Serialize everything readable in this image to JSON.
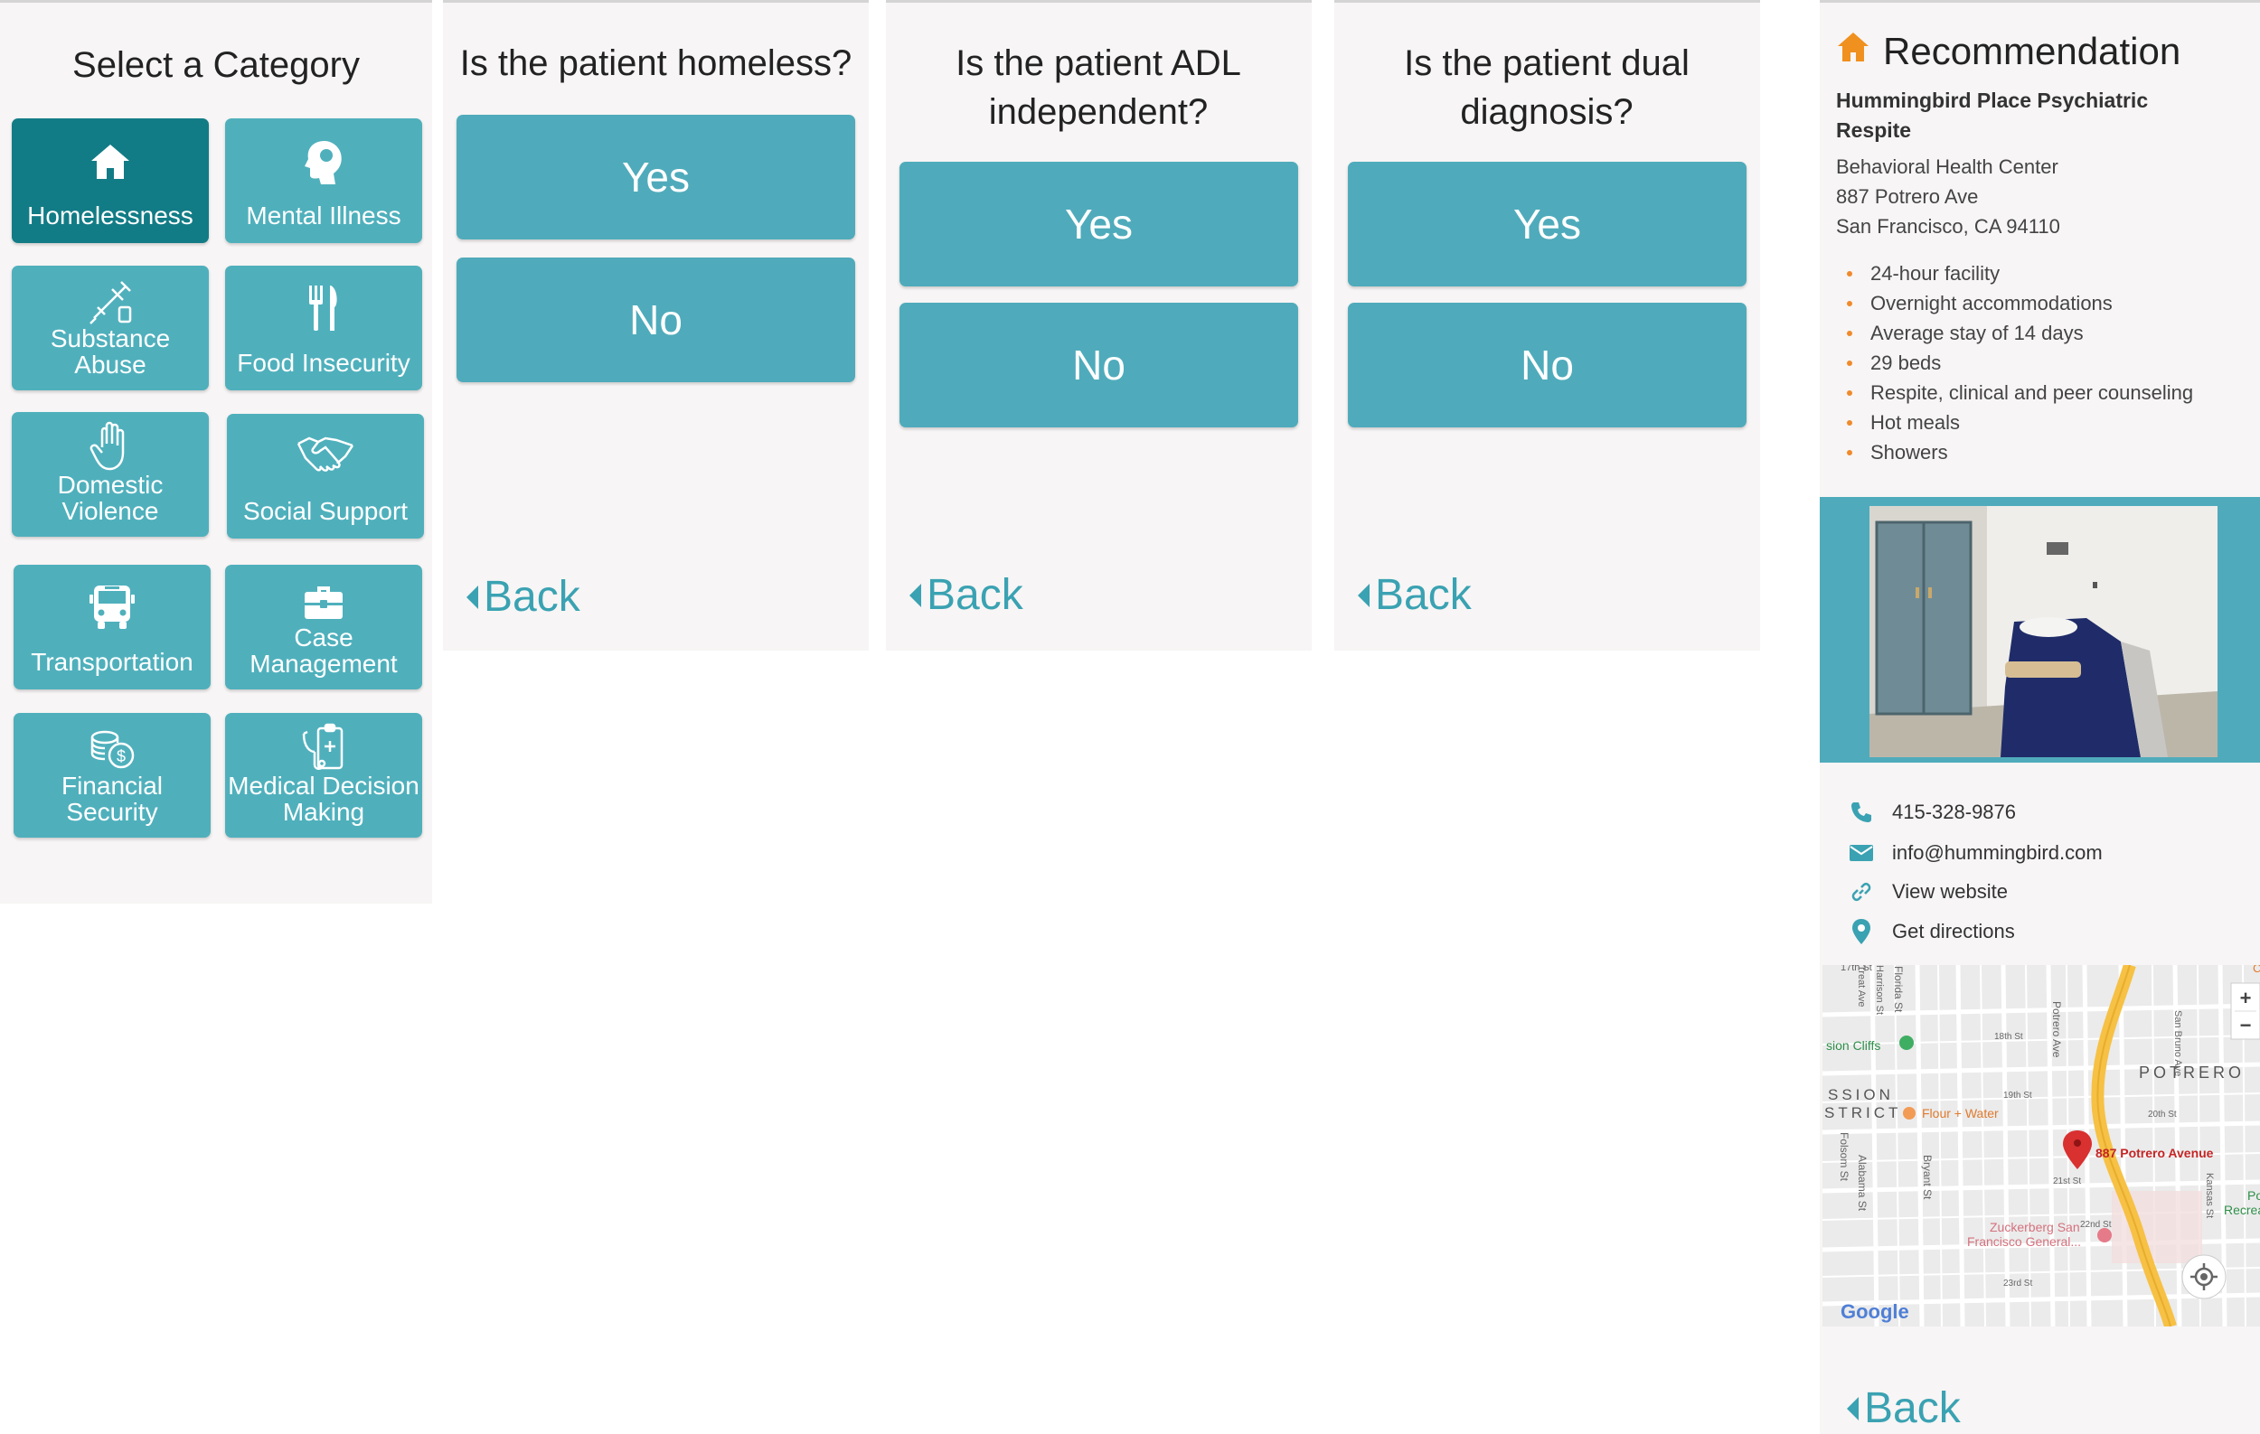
{
  "categories": {
    "title": "Select a Category",
    "items": [
      {
        "label": "Homelessness",
        "icon": "house-icon"
      },
      {
        "label": "Mental Illness",
        "icon": "head-icon"
      },
      {
        "label": "Substance Abuse",
        "icon": "syringe-icon"
      },
      {
        "label": "Food Insecurity",
        "icon": "fork-knife-icon"
      },
      {
        "label": "Domestic Violence",
        "icon": "raised-hand-icon"
      },
      {
        "label": "Social Support",
        "icon": "handshake-icon"
      },
      {
        "label": "Transportation",
        "icon": "bus-icon"
      },
      {
        "label": "Case Management",
        "icon": "briefcase-icon"
      },
      {
        "label": "Financial Security",
        "icon": "coins-icon"
      },
      {
        "label": "Medical Decision Making",
        "icon": "medical-clipboard-icon"
      }
    ]
  },
  "questions": [
    {
      "text": "Is the patient homeless?",
      "yes": "Yes",
      "no": "No",
      "back": "Back"
    },
    {
      "text": "Is the patient ADL independent?",
      "yes": "Yes",
      "no": "No",
      "back": "Back"
    },
    {
      "text": "Is the patient dual diagnosis?",
      "yes": "Yes",
      "no": "No",
      "back": "Back"
    }
  ],
  "recommendation": {
    "title": "Recommendation",
    "name": "Hummingbird Place Psychiatric Respite",
    "type": "Behavioral Health Center",
    "street": "887 Potrero Ave",
    "city": "San Francisco, CA 94110",
    "features": [
      "24-hour facility",
      "Overnight accommodations",
      "Average stay of 14 days",
      "29 beds",
      "Respite, clinical and peer counseling",
      "Hot meals",
      "Showers"
    ],
    "phone": "415-328-9876",
    "email": "info@hummingbird.com",
    "website": "View website",
    "directions": "Get directions",
    "back": "Back"
  },
  "map": {
    "marker_label": "887 Potrero Avenue",
    "district_1": "SSION",
    "district_2": "STRICT",
    "neighborhood": "POTRERO",
    "places": [
      "sion Cliffs",
      "Flour + Water",
      "Zuckerberg San",
      "Francisco General..."
    ],
    "streets": [
      "17th St",
      "18th St",
      "19th St",
      "20th St",
      "21st St",
      "22nd St",
      "23rd St",
      "Folsom St",
      "Potrero Ave",
      "Bryant St",
      "Florida St",
      "Alabama St",
      "Treat Ave",
      "Harrison St",
      "Kansas St",
      "San Bruno Ave"
    ],
    "right_edge": [
      "Co",
      "Po",
      "Recreatio"
    ],
    "google": "Google",
    "zoom_in": "+",
    "zoom_out": "−",
    "colors": {
      "highway": "#f6c144",
      "marker": "#d93030",
      "park": "#c9e7c2"
    }
  },
  "colors": {
    "accent": "#4fabbb",
    "accent_dark": "#127c86",
    "bullet": "#ef8a2c",
    "home_icon": "#f0901e"
  }
}
